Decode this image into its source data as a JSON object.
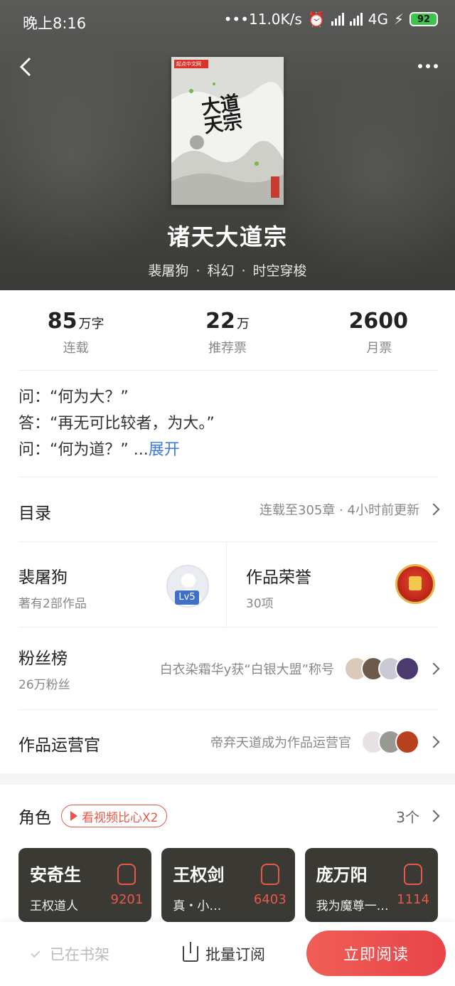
{
  "status": {
    "time": "晚上8:16",
    "net_speed": "•••11.0K/s",
    "network": "4G",
    "battery": "92"
  },
  "book": {
    "title": "诸天大道宗",
    "cover_title": "大道天宗",
    "author": "裴屠狗",
    "category": "科幻",
    "subcategory": "时空穿梭",
    "dot": "·"
  },
  "stats": [
    {
      "num": "85",
      "unit": "万字",
      "label": "连载"
    },
    {
      "num": "22",
      "unit": "万",
      "label": "推荐票"
    },
    {
      "num": "2600",
      "unit": "",
      "label": "月票"
    }
  ],
  "intro": {
    "line1": "问：“何为大？”",
    "line2": "答：“再无可比较者，为大。”",
    "line3": "问：“何为道？”",
    "ellipsis": " ...",
    "expand": "展开"
  },
  "toc": {
    "title": "目录",
    "info": "连载至305章 · 4小时前更新"
  },
  "author_card": {
    "name": "裴屠狗",
    "works": "著有2部作品",
    "level": "Lv5"
  },
  "honor": {
    "title": "作品荣誉",
    "count": "30项"
  },
  "fans": {
    "title": "粉丝榜",
    "count": "26万粉丝",
    "news": "白衣染霜华y获“白银大盟”称号"
  },
  "operator": {
    "title": "作品运营官",
    "news": "帝弃天道成为作品运营官"
  },
  "roles": {
    "title": "角色",
    "video_badge": "看视频比心X2",
    "count": "3个",
    "items": [
      {
        "name": "安奇生",
        "role": "王权道人",
        "hearts": "9201"
      },
      {
        "name": "王权剑",
        "role": "真・小…",
        "hearts": "6403"
      },
      {
        "name": "庞万阳",
        "role": "我为魔尊一…",
        "hearts": "1114"
      }
    ]
  },
  "bottom": {
    "shelf": "已在书架",
    "batch": "批量订阅",
    "read": "立即阅读"
  },
  "colors": {
    "accent": "#e8444a",
    "link": "#3a7bd5",
    "card_bg": "#3a3934"
  }
}
